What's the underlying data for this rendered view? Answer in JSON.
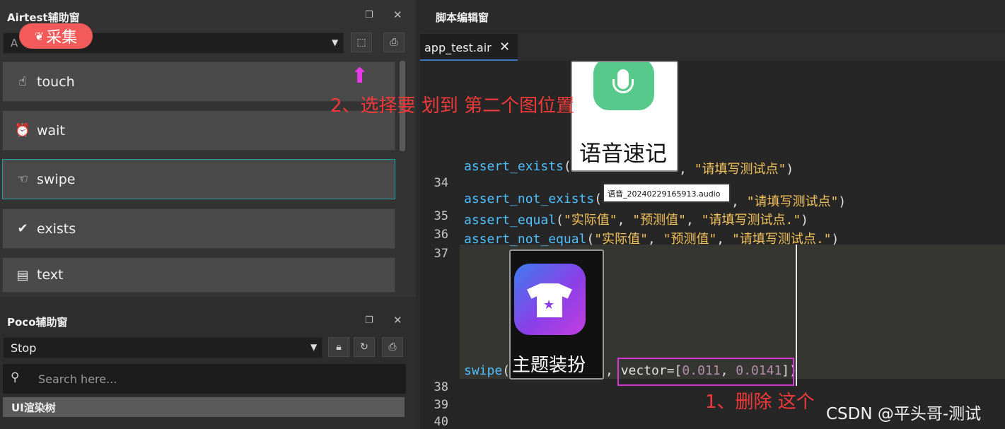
{
  "collect_badge": {
    "label": "采集"
  },
  "airtest_panel": {
    "title": "Airtest辅助窗",
    "device_combo_partial": "A",
    "actions": [
      {
        "label": "touch",
        "icon": "hand-tap-icon"
      },
      {
        "label": "wait",
        "icon": "alarm-clock-icon"
      },
      {
        "label": "swipe",
        "icon": "swipe-hand-icon"
      },
      {
        "label": "exists",
        "icon": "check-search-icon"
      },
      {
        "label": "text",
        "icon": "text-box-icon"
      }
    ]
  },
  "poco_panel": {
    "title": "Poco辅助窗",
    "mode_value": "Stop",
    "search_placeholder": "Search here...",
    "tree_header": "UI渲染树"
  },
  "editor": {
    "window_title": "脚本编辑窗",
    "tab_label": "app_test.air",
    "tab_close": "✕",
    "line_numbers": [
      "34",
      "35",
      "36",
      "37",
      "38",
      "39",
      "40"
    ],
    "code": {
      "assert_exists": {
        "fn": "assert_exists",
        "open": "(",
        "sep": ", ",
        "msg": "\"请填写测试点\"",
        "close": ")"
      },
      "assert_not_exists": {
        "fn": "assert_not_exists",
        "open": "(",
        "sep": ", ",
        "msg": "\"请填写测试点\"",
        "close": ")"
      },
      "assert_equal": {
        "fn": "assert_equal",
        "open": "(",
        "a": "\"实际值\"",
        "b": "\"预测值\"",
        "msg": "\"请填写测试点.\"",
        "close": ")",
        "comma": ", "
      },
      "assert_not_equal": {
        "fn": "assert_not_equal",
        "open": "(",
        "a": "\"实际值\"",
        "b": "\"预测值\"",
        "msg": "\"请填写测试点.\"",
        "close": ")",
        "comma": ", "
      },
      "swipe": {
        "fn": "swipe",
        "open": "(",
        "sep": ", ",
        "kw": "vector=[",
        "v1": "0.011",
        "vsep": ", ",
        "v2": "0.0141",
        "kw_close": "]",
        "close": ")"
      }
    },
    "images": {
      "voice_label": "语音速记",
      "audio_file": "语音_20240229165913.audio",
      "theme_label": "主题装扮"
    }
  },
  "annotations": {
    "step2": "2、选择要 划到 第二个图位置",
    "step1": "1、删除 这个"
  },
  "watermark": "CSDN @平头哥-测试",
  "colors": {
    "red_note": "#f03a3a",
    "magenta_box": "#d63ad6",
    "selected_border": "#23a3a8"
  }
}
